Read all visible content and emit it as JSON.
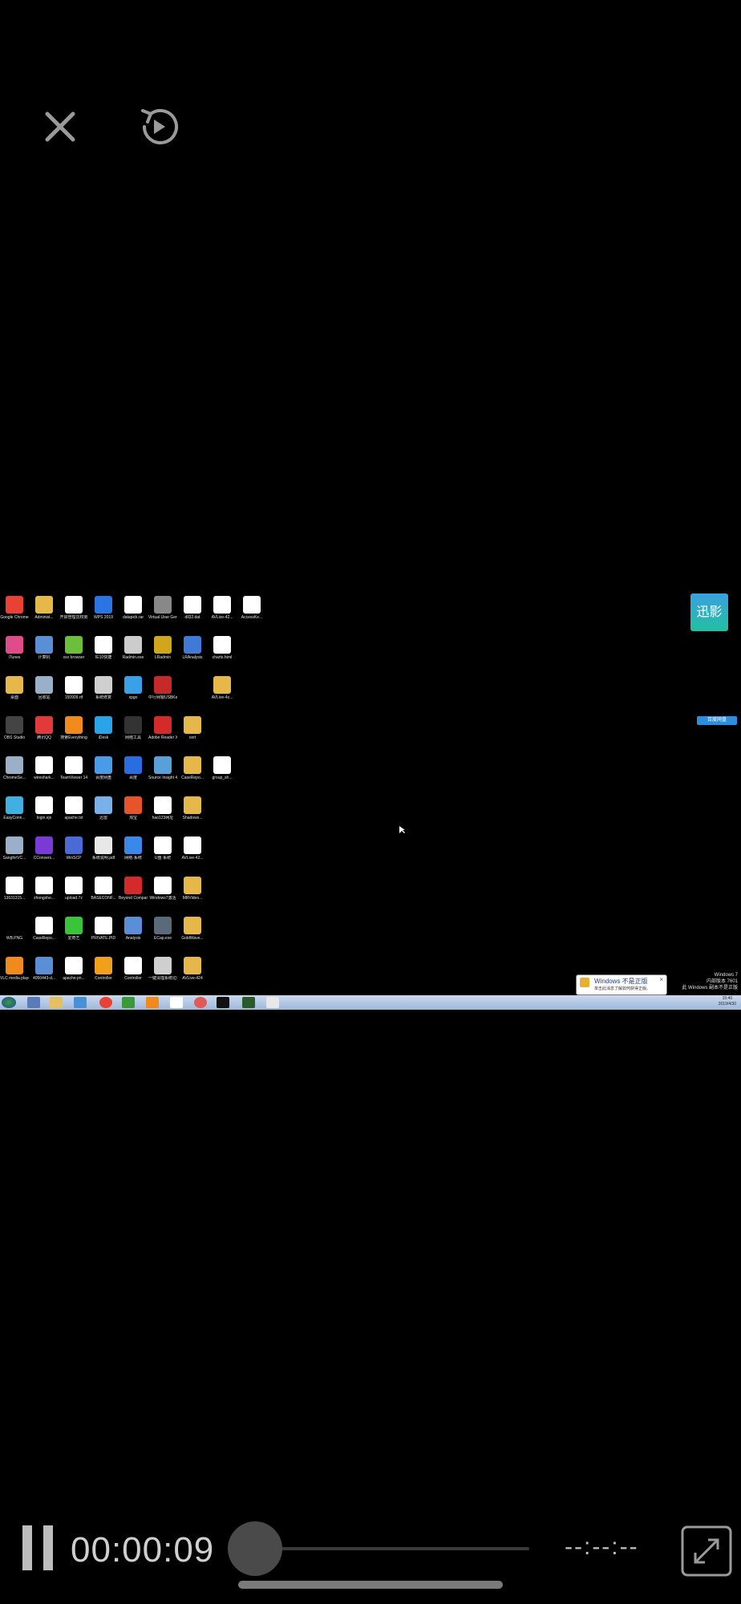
{
  "player": {
    "current_time": "00:00:09",
    "remaining_time": "--:--:--",
    "progress_fraction": 0.06
  },
  "watermark": {
    "text": "迅影"
  },
  "desktop": {
    "icons": [
      {
        "label": "Google Chrome",
        "color": "#e94235"
      },
      {
        "label": "Administ...",
        "color": "#e6b84a"
      },
      {
        "label": "开启管理员权限",
        "color": "#ffffff"
      },
      {
        "label": "WPS 2019",
        "color": "#2b74e4"
      },
      {
        "label": "datapick.rar",
        "color": "#ffffff"
      },
      {
        "label": "Virtual User Generator",
        "color": "#888888"
      },
      {
        "label": "dll32.dat",
        "color": "#ffffff"
      },
      {
        "label": "AVLive-42...",
        "color": "#ffffff"
      },
      {
        "label": "AccessKe...",
        "color": "#ffffff"
      },
      {
        "label": "iTunes",
        "color": "#e04c8a"
      },
      {
        "label": "计算机",
        "color": "#5a8fd8"
      },
      {
        "label": "xxx browser",
        "color": "#6bbf3a"
      },
      {
        "label": "IE10快捷",
        "color": "#ffffff"
      },
      {
        "label": "Radmin.exe",
        "color": "#cccccc"
      },
      {
        "label": "LRadmin",
        "color": "#d1a51c"
      },
      {
        "label": "LRAnalysis",
        "color": "#3f7ad6"
      },
      {
        "label": "charts.html",
        "color": "#ffffff"
      },
      {
        "label": "",
        "color": "#000000"
      },
      {
        "label": "桌面",
        "color": "#e6b84a"
      },
      {
        "label": "回收站",
        "color": "#9ab0c8"
      },
      {
        "label": "150909.rtf",
        "color": "#ffffff"
      },
      {
        "label": "系统修复",
        "color": "#cfcfcf"
      },
      {
        "label": "xpgo",
        "color": "#3aa0e8"
      },
      {
        "label": "中行网银USBKey",
        "color": "#c42a2a"
      },
      {
        "label": "",
        "color": "#000000"
      },
      {
        "label": "AVLive-4z...",
        "color": "#e6b84a"
      },
      {
        "label": "",
        "color": "#000000"
      },
      {
        "label": "OBS Studio",
        "color": "#444444"
      },
      {
        "label": "腾讯QQ",
        "color": "#e23a3a"
      },
      {
        "label": "搜索Everything",
        "color": "#f08a1c"
      },
      {
        "label": "iDesk",
        "color": "#2aa4e8"
      },
      {
        "label": "网络工具",
        "color": "#333333"
      },
      {
        "label": "Adobe Reader XI",
        "color": "#d42a2a"
      },
      {
        "label": "cert",
        "color": "#e6b84a"
      },
      {
        "label": "",
        "color": "#000000"
      },
      {
        "label": "",
        "color": "#000000"
      },
      {
        "label": "ChromeSe...",
        "color": "#9ab0c8"
      },
      {
        "label": "wireshark...",
        "color": "#ffffff"
      },
      {
        "label": "TeamViewer 14",
        "color": "#ffffff"
      },
      {
        "label": "百度网盘",
        "color": "#4a9be8"
      },
      {
        "label": "百度",
        "color": "#2a6de0"
      },
      {
        "label": "Source Insight 4.0",
        "color": "#5aa0d8"
      },
      {
        "label": "CaseRepo...",
        "color": "#e6b84a"
      },
      {
        "label": "group_sh...",
        "color": "#ffffff"
      },
      {
        "label": "",
        "color": "#000000"
      },
      {
        "label": "EasyConn...",
        "color": "#3fb0e0"
      },
      {
        "label": "login.ejs",
        "color": "#ffffff"
      },
      {
        "label": "apache.txt",
        "color": "#ffffff"
      },
      {
        "label": "迅雷",
        "color": "#7ab0e8"
      },
      {
        "label": "淘宝",
        "color": "#e8542a"
      },
      {
        "label": "hao123网址",
        "color": "#ffffff"
      },
      {
        "label": "Shadows...",
        "color": "#e6b84a"
      },
      {
        "label": "",
        "color": "#000000"
      },
      {
        "label": "",
        "color": "#000000"
      },
      {
        "label": "SangforVC...",
        "color": "#9ab0c8"
      },
      {
        "label": "CConvers...",
        "color": "#7a3ad6"
      },
      {
        "label": "WinSCP",
        "color": "#4a6ad6"
      },
      {
        "label": "系统说明.pdf",
        "color": "#e8e8e8"
      },
      {
        "label": "网络·系统",
        "color": "#3a88e8"
      },
      {
        "label": "U盘·系统",
        "color": "#ffffff"
      },
      {
        "label": "AVLive-42...",
        "color": "#ffffff"
      },
      {
        "label": "",
        "color": "#000000"
      },
      {
        "label": "",
        "color": "#000000"
      },
      {
        "label": "13631315...",
        "color": "#ffffff"
      },
      {
        "label": "zhongshe...",
        "color": "#ffffff"
      },
      {
        "label": "upload.7z",
        "color": "#ffffff"
      },
      {
        "label": "BASECONF...",
        "color": "#ffffff"
      },
      {
        "label": "Beyond Compare 4",
        "color": "#d42a2a"
      },
      {
        "label": "Windows7激活",
        "color": "#ffffff"
      },
      {
        "label": "MRVideo...",
        "color": "#e6b84a"
      },
      {
        "label": "",
        "color": "#000000"
      },
      {
        "label": "",
        "color": "#000000"
      },
      {
        "label": "WB.PNG",
        "color": "#000000"
      },
      {
        "label": "CaseRepo...",
        "color": "#ffffff"
      },
      {
        "label": "爱奇艺",
        "color": "#3ac43a"
      },
      {
        "label": "PRIVATE.PID",
        "color": "#ffffff"
      },
      {
        "label": "Analysis",
        "color": "#5a8fd8"
      },
      {
        "label": "ECap.exe",
        "color": "#5a6a7a"
      },
      {
        "label": "GoldWave...",
        "color": "#e6b84a"
      },
      {
        "label": "",
        "color": "#000000"
      },
      {
        "label": "",
        "color": "#000000"
      },
      {
        "label": "VLC media player",
        "color": "#f08a1c"
      },
      {
        "label": "4050443-d...",
        "color": "#5a8fd8"
      },
      {
        "label": "apache-jm...",
        "color": "#ffffff"
      },
      {
        "label": "Controller",
        "color": "#f0a01c"
      },
      {
        "label": "Controller",
        "color": "#ffffff"
      },
      {
        "label": "一键清理系统垃圾文件.bat",
        "color": "#cfcfcf"
      },
      {
        "label": "AVLive-424",
        "color": "#e6b84a"
      },
      {
        "label": "",
        "color": "#000000"
      },
      {
        "label": "",
        "color": "#000000"
      }
    ],
    "notification": {
      "title": "Windows 不是正版",
      "body": "单击此消息了解如何获得正版。"
    },
    "corner_text": {
      "line1": "Windows 7",
      "line2": "内部版本 7601",
      "line3": "此 Windows 副本不是正版",
      "time": "15:40",
      "date": "2019/4/30"
    },
    "side_tag": "百度网盘"
  }
}
